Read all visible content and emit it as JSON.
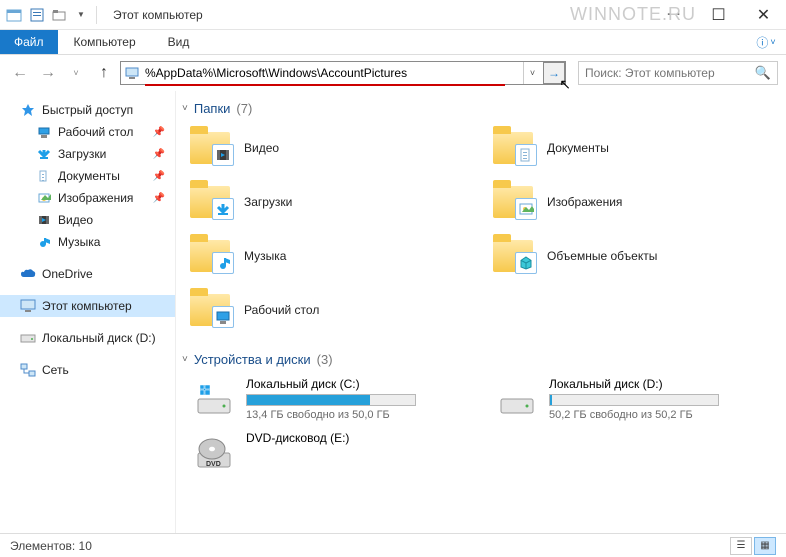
{
  "window": {
    "title": "Этот компьютер",
    "watermark": "WINNOTE.RU"
  },
  "ribbon": {
    "file": "Файл",
    "tabs": [
      "Компьютер",
      "Вид"
    ]
  },
  "address": {
    "path": "%AppData%\\Microsoft\\Windows\\AccountPictures"
  },
  "search": {
    "placeholder": "Поиск: Этот компьютер"
  },
  "nav": {
    "quick": "Быстрый доступ",
    "quick_items": [
      {
        "label": "Рабочий стол",
        "pinned": true,
        "icon": "desktop"
      },
      {
        "label": "Загрузки",
        "pinned": true,
        "icon": "downloads"
      },
      {
        "label": "Документы",
        "pinned": true,
        "icon": "documents"
      },
      {
        "label": "Изображения",
        "pinned": true,
        "icon": "pictures"
      },
      {
        "label": "Видео",
        "pinned": false,
        "icon": "video"
      },
      {
        "label": "Музыка",
        "pinned": false,
        "icon": "music"
      }
    ],
    "onedrive": "OneDrive",
    "thispc": "Этот компьютер",
    "localdisk": "Локальный диск (D:)",
    "network": "Сеть"
  },
  "groups": {
    "folders_label": "Папки",
    "folders_count": "(7)",
    "drives_label": "Устройства и диски",
    "drives_count": "(3)"
  },
  "folders": [
    {
      "label": "Видео",
      "icon": "video"
    },
    {
      "label": "Документы",
      "icon": "documents"
    },
    {
      "label": "Загрузки",
      "icon": "downloads"
    },
    {
      "label": "Изображения",
      "icon": "pictures"
    },
    {
      "label": "Музыка",
      "icon": "music"
    },
    {
      "label": "Объемные объекты",
      "icon": "3d"
    },
    {
      "label": "Рабочий стол",
      "icon": "desktop"
    }
  ],
  "drives": [
    {
      "label": "Локальный диск (C:)",
      "free": "13,4 ГБ свободно из 50,0 ГБ",
      "fill": 73,
      "icon": "hdd-win"
    },
    {
      "label": "Локальный диск (D:)",
      "free": "50,2 ГБ свободно из 50,2 ГБ",
      "fill": 1,
      "icon": "hdd"
    },
    {
      "label": "DVD-дисковод (E:)",
      "free": "",
      "fill": -1,
      "icon": "dvd"
    }
  ],
  "status": {
    "elements": "Элементов: 10"
  }
}
